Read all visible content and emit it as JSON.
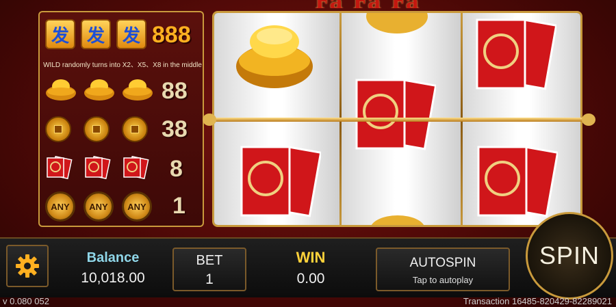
{
  "game_title_fragment": "Fa Fa Fa",
  "paytable": {
    "wild_glyph": "发",
    "wild_multiplier": "888",
    "wild_note": "WILD randomly turns into X2、X5、X8 in the middle",
    "rows": [
      {
        "symbol": "gold-ingot",
        "multiplier": "88"
      },
      {
        "symbol": "gold-coin",
        "multiplier": "38"
      },
      {
        "symbol": "red-envelope",
        "multiplier": "8"
      },
      {
        "symbol": "any-coin",
        "label": "ANY",
        "multiplier": "1"
      }
    ]
  },
  "reels": [
    {
      "symbols": [
        "gold-ingot",
        "red-envelope"
      ]
    },
    {
      "symbols": [
        "red-envelope",
        "coin-partial"
      ]
    },
    {
      "symbols": [
        "red-envelope",
        "red-envelope"
      ]
    }
  ],
  "bottom_bar": {
    "balance_label": "Balance",
    "balance_value": "10,018.00",
    "bet_label": "BET",
    "bet_value": "1",
    "win_label": "WIN",
    "win_value": "0.00",
    "autospin_label": "AUTOSPIN",
    "autospin_hint": "Tap to autoplay",
    "spin_label": "SPIN",
    "settings_icon": "gear-icon"
  },
  "footer": {
    "version": "v  0.080   052",
    "transaction": "Transaction  16485-820429-82289021"
  },
  "colors": {
    "background": "#4a0806",
    "frame_gold": "#c99a3c",
    "envelope_red": "#d0161a",
    "win_yellow": "#ffd23a",
    "balance_teal": "#8fd6e8"
  }
}
